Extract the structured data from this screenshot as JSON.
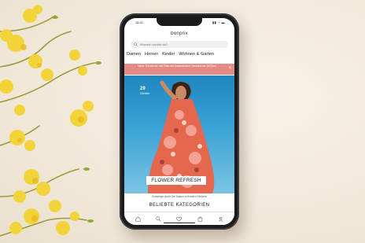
{
  "phone": {
    "status_time": "15:41",
    "status_icons": "▮▮ ◔ ▬",
    "brand": "bonprix",
    "search_placeholder": "Wonach suchst du?",
    "nav_items": [
      "Damen",
      "Herren",
      "Kinder",
      "Wohnen & Garten"
    ],
    "promo_text": "Neue Trends für alle Stile mit kostenlosem Versand ab 39 Euro",
    "promo_close": "×",
    "hero_price_small": "29",
    "hero_price_label": "Kleider",
    "hero_title": "FLOWER REFRESH",
    "hero_subtitle": "Schwelge durch die Saison in floralen Kleidern",
    "section_heading": "BELIEBTE KATEGORIEN"
  },
  "colors": {
    "background": "#f5efe4",
    "promo": "#e58a86",
    "hero_sky": "#2f95cc",
    "flower": "#f2d43a"
  },
  "icons": {
    "tab_icons": [
      "home-icon",
      "search-icon",
      "heart-icon",
      "bag-icon",
      "user-icon"
    ]
  }
}
